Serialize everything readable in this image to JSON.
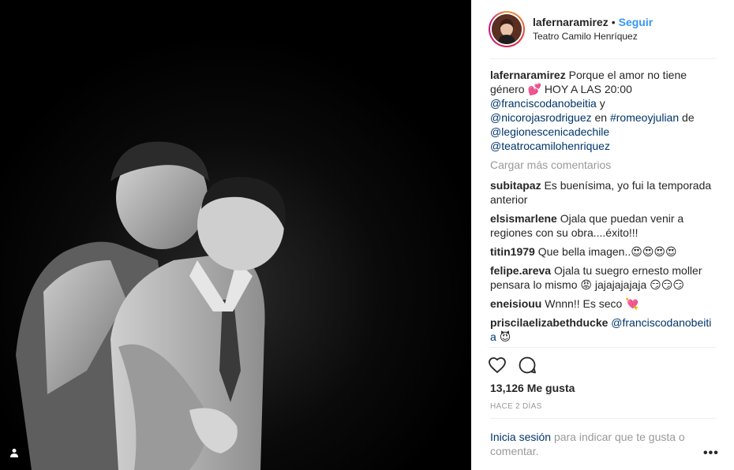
{
  "post": {
    "username": "lafernaramirez",
    "separator": "•",
    "follow_label": "Seguir",
    "location": "Teatro Camilo Henríquez"
  },
  "caption": {
    "user": "lafernaramirez",
    "text1": "Porque el amor no tiene género",
    "emoji1": "💕",
    "text2": "HOY A LAS 20:00",
    "m1": "@franciscodanobeitia",
    "y": "y",
    "m2": "@nicorojasrodriguez",
    "en": "en",
    "tag": "#romeoyjulian",
    "de": "de",
    "m3": "@legionescenicadechile",
    "m4": "@teatrocamilohenriquez"
  },
  "load_more": "Cargar más comentarios",
  "comments": [
    {
      "user": "subitapaz",
      "text": "Es buenísima, yo fui la temporada anterior"
    },
    {
      "user": "elsismarlene",
      "text": "Ojala que puedan venir a regiones con su obra....éxito!!!"
    },
    {
      "user": "titin1979",
      "text": "Que bella imagen..😍😍😍😍"
    },
    {
      "user": "felipe.areva",
      "text": "Ojala tu suegro ernesto moller pensara lo mismo 😡 jajajajajaja 😏😏😏"
    },
    {
      "user": "eneisiouu",
      "text": "Wnnn!! Es seco 💘"
    },
    {
      "user": "priscilaelizabethducke",
      "mention": "@franciscodanobeitia",
      "emoji": "😈"
    }
  ],
  "likes": "13,126 Me gusta",
  "time_ago": "HACE 2 DÍAS",
  "login": {
    "link": "Inicia sesión",
    "text": "para indicar que te gusta o comentar."
  },
  "more_label": "•••",
  "icons": {
    "like": "heart-icon",
    "comment": "comment-icon",
    "tag": "user-tag-icon"
  },
  "colors": {
    "accent": "#3897f0",
    "mention": "#003569",
    "muted": "#999999"
  }
}
